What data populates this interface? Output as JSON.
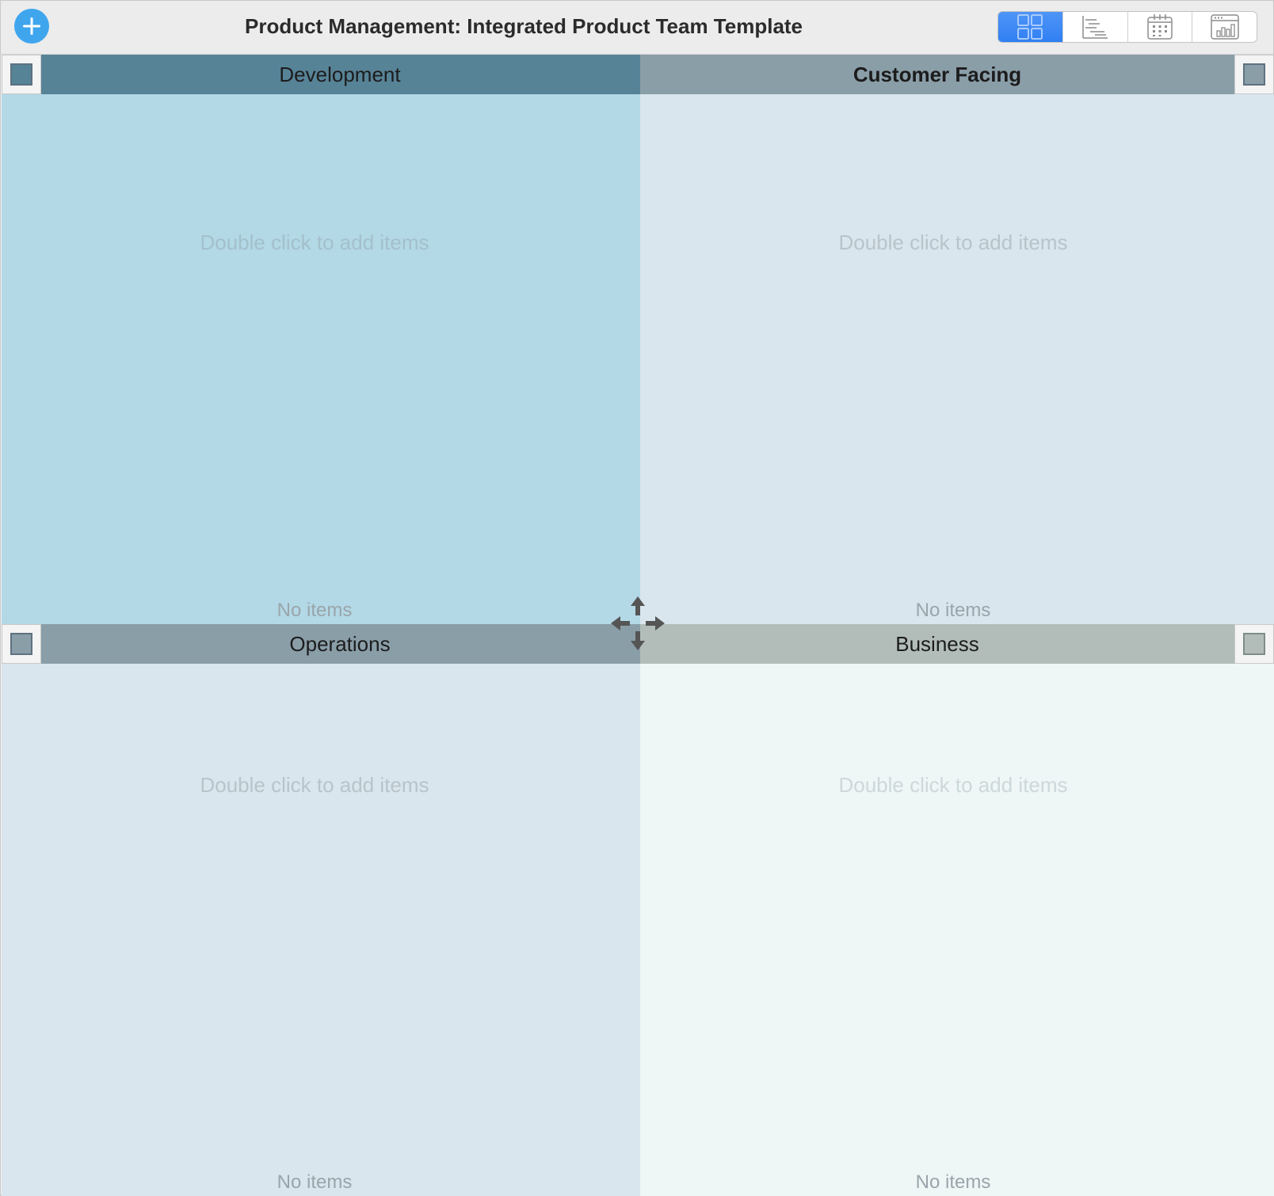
{
  "app": {
    "title": "Product Management: Integrated Product Team Template"
  },
  "toolbar": {
    "add_icon": "plus-circle-icon",
    "add_color": "#3fa6ee",
    "views": [
      {
        "icon": "grid-view-icon",
        "active": true
      },
      {
        "icon": "outline-view-icon",
        "active": false
      },
      {
        "icon": "calendar-view-icon",
        "active": false
      },
      {
        "icon": "chart-view-icon",
        "active": false
      }
    ],
    "active_color": "#2f7ff2"
  },
  "quadrants": {
    "development": {
      "title": "Development",
      "hint": "Double click to add items",
      "count_label": "No items",
      "header_color": "#578397",
      "body_color": "#b3d8e6"
    },
    "customer_facing": {
      "title": "Customer Facing",
      "hint": "Double click to add items",
      "count_label": "No items",
      "header_color": "#8a9ea8",
      "body_color": "#d9e6ee"
    },
    "operations": {
      "title": "Operations",
      "hint": "Double click to add items",
      "count_label": "No items",
      "header_color": "#8a9ea8",
      "body_color": "#d9e6ee"
    },
    "business": {
      "title": "Business",
      "hint": "Double click to add items",
      "count_label": "No items",
      "header_color": "#b2bdba",
      "body_color": "#eef6f6"
    }
  },
  "center_handle": {
    "icon": "move-arrows-icon"
  }
}
